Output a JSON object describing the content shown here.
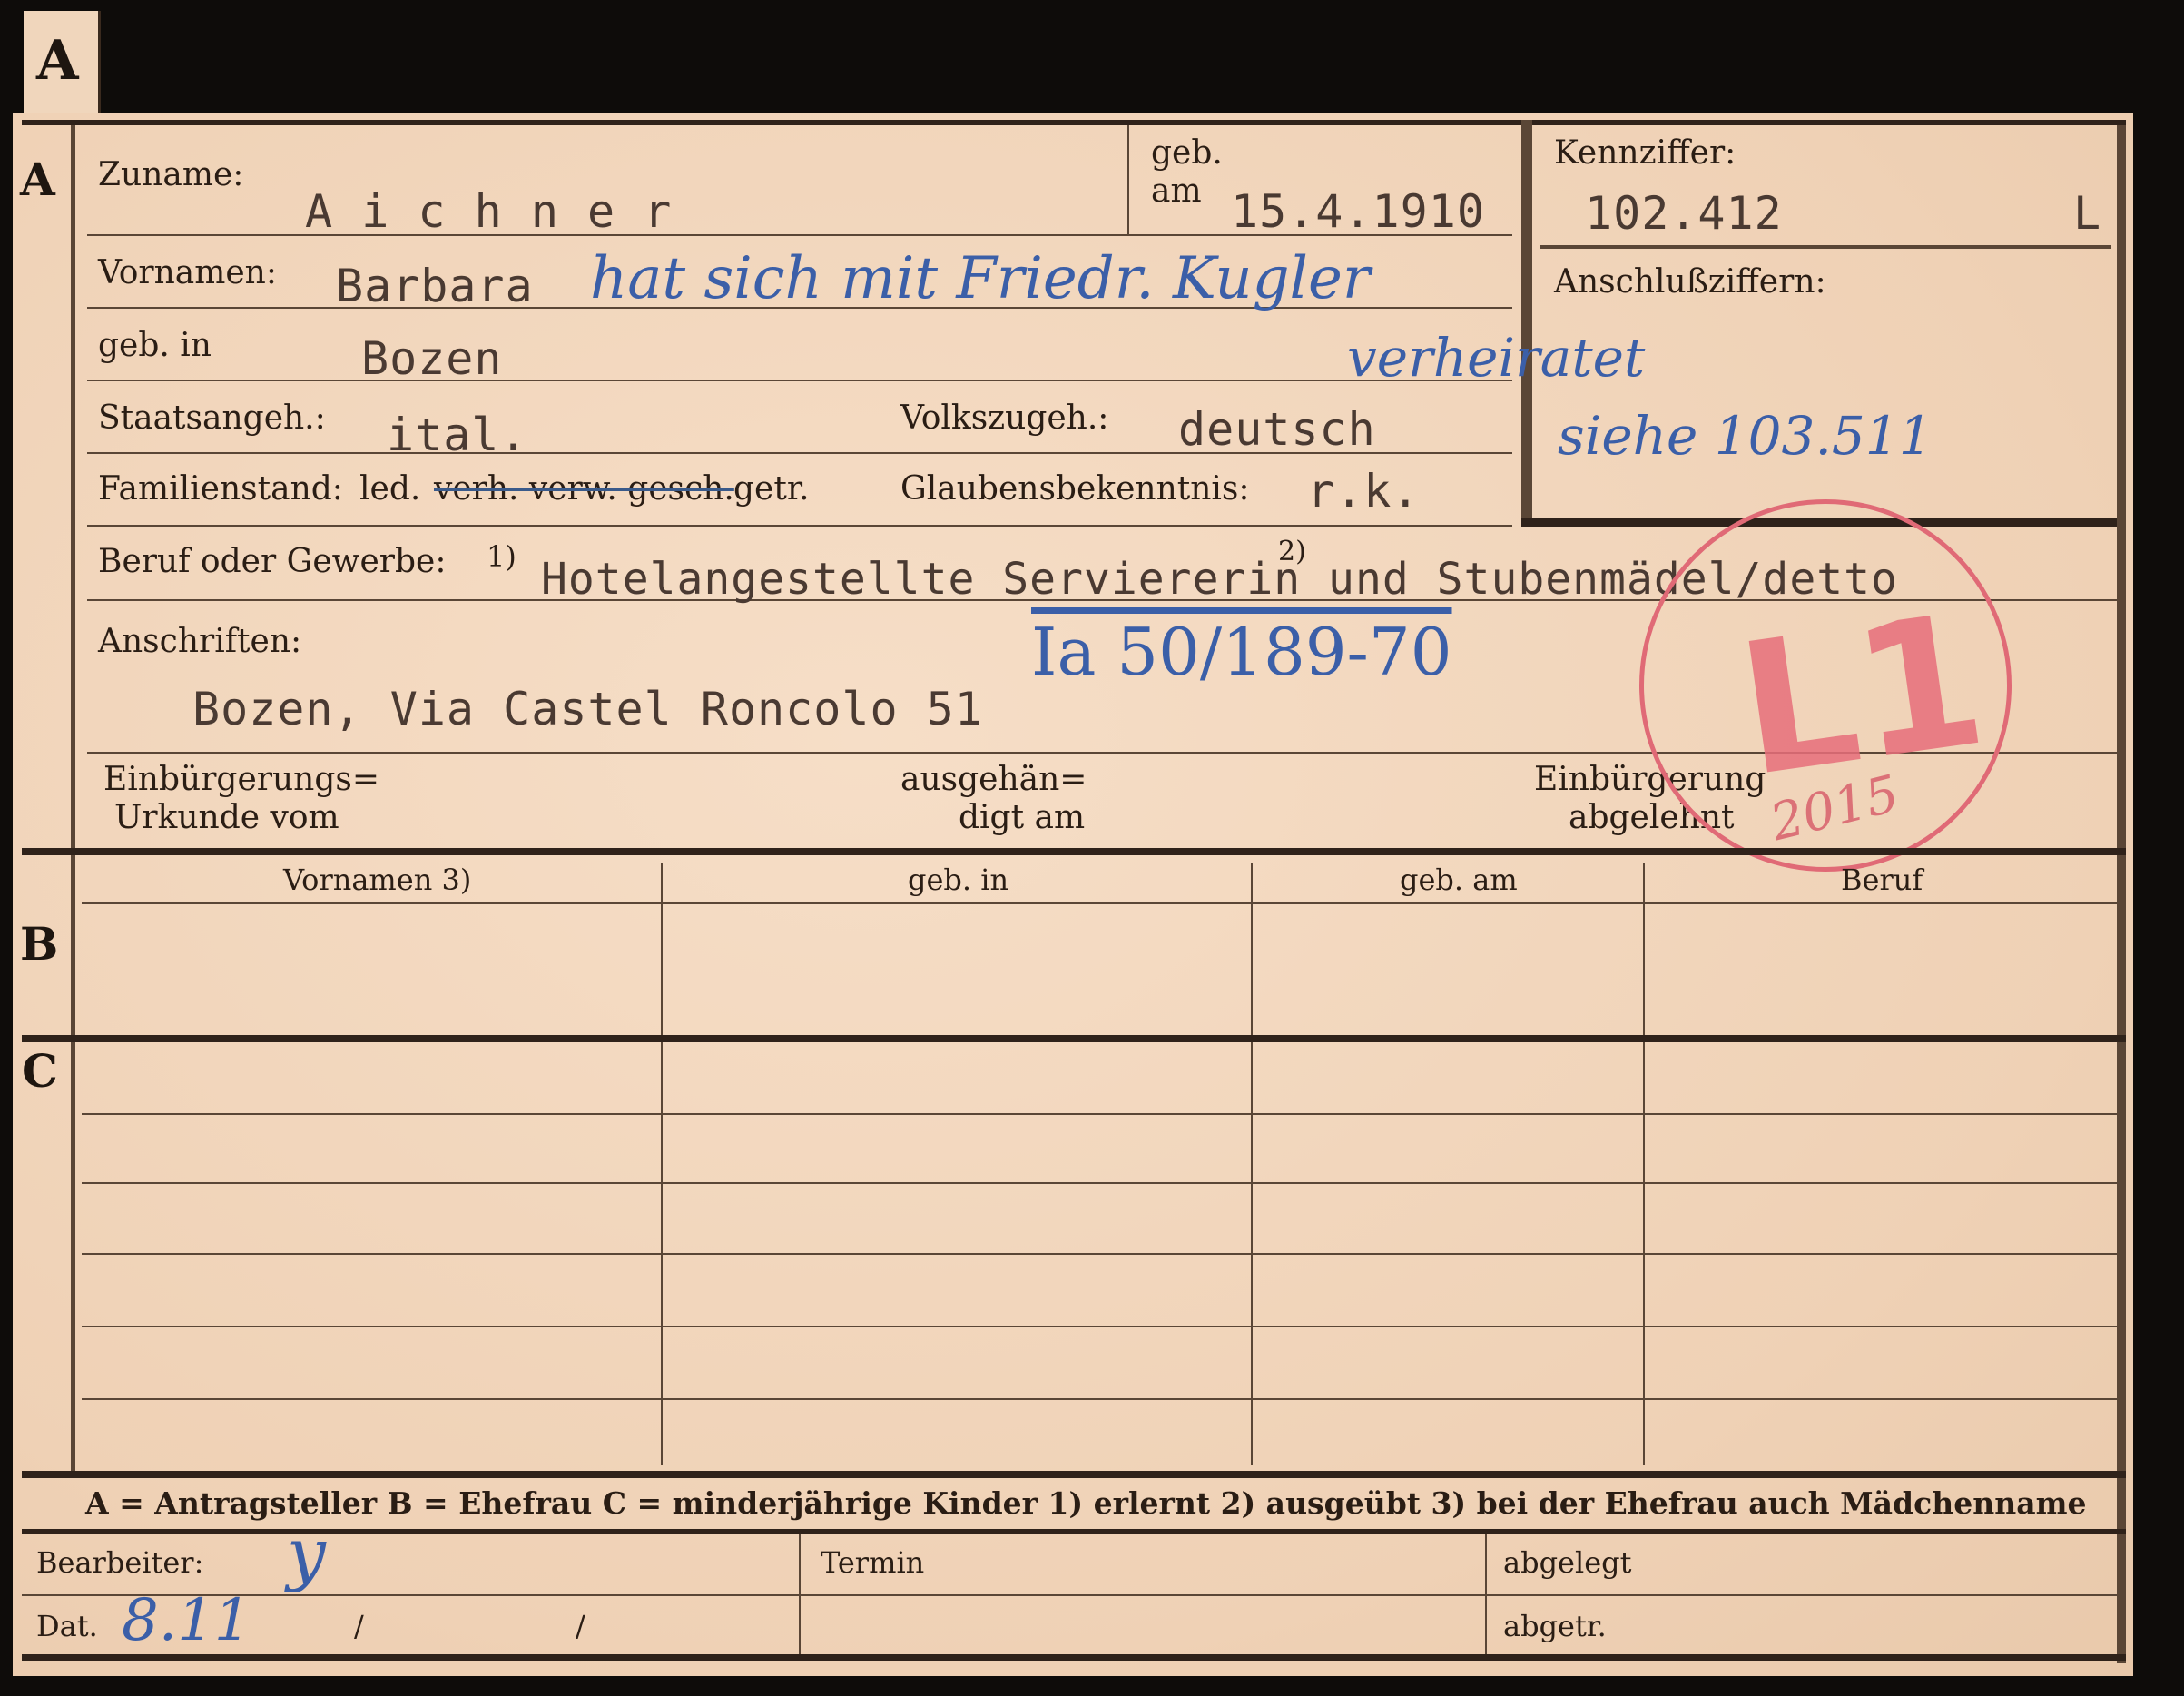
{
  "tab_letter": "A",
  "section_letters": {
    "a": "A",
    "b": "B",
    "c": "C"
  },
  "labels": {
    "zuname": "Zuname:",
    "geb": "geb.",
    "am": "am",
    "kennziffer": "Kennziffer:",
    "vornamen": "Vornamen:",
    "anschluss": "Anschlußziffern:",
    "geb_in": "geb. in",
    "staatsangeh": "Staatsangeh.:",
    "volkszugeh": "Volkszugeh.:",
    "familienstand": "Familienstand:",
    "fam_led": "led.",
    "fam_struck": "verh. verw. gesch.",
    "fam_getr": "getr.",
    "glaubens": "Glaubensbekenntnis:",
    "beruf": "Beruf oder Gewerbe:",
    "beruf_note1": "1)",
    "beruf_note2": "2)",
    "anschriften": "Anschriften:",
    "einb_urk_1": "Einbürgerungs=",
    "einb_urk_2": "Urkunde vom",
    "ausgeh_1": "ausgehän=",
    "ausgeh_2": "digt am",
    "einb_abg_1": "Einbürgerung",
    "einb_abg_2": "abgelehnt"
  },
  "values": {
    "zuname": "A i c h n e r",
    "geb_am": "15.4.1910",
    "kennziffer": "102.412",
    "kennziffer_suffix": "L",
    "vornamen": "Barbara",
    "geb_in": "Bozen",
    "staatsangeh": "ital.",
    "volkszugeh": "deutsch",
    "glaubens": "r.k.",
    "beruf": "Hotelangestellte Serviererin und Stubenmädel/detto",
    "anschrift": "Bozen, Via Castel Roncolo 51"
  },
  "handwritten": {
    "vornamen_note": "hat sich mit Friedr. Kugler",
    "vornamen_note_2": "verheiratet",
    "anschluss_note": "siehe 103.511",
    "aktenzeichen": "Ia 50/189-70",
    "bearbeiter_mark": "y",
    "datum": "8.11"
  },
  "stamp": {
    "text": "L1",
    "number": "2015",
    "color": "#e06a76"
  },
  "table_headers": [
    "Vornamen 3)",
    "geb. in",
    "geb. am",
    "Beruf"
  ],
  "legend": "A = Antragsteller   B = Ehefrau   C = minderjährige Kinder   1) erlernt   2) ausgeübt   3) bei der Ehefrau auch Mädchenname",
  "footer": {
    "bearbeiter": "Bearbeiter:",
    "dat": "Dat.",
    "slash1": "/",
    "slash2": "/",
    "termin": "Termin",
    "abgelegt": "abgelegt",
    "abgetr": "abgetr."
  }
}
